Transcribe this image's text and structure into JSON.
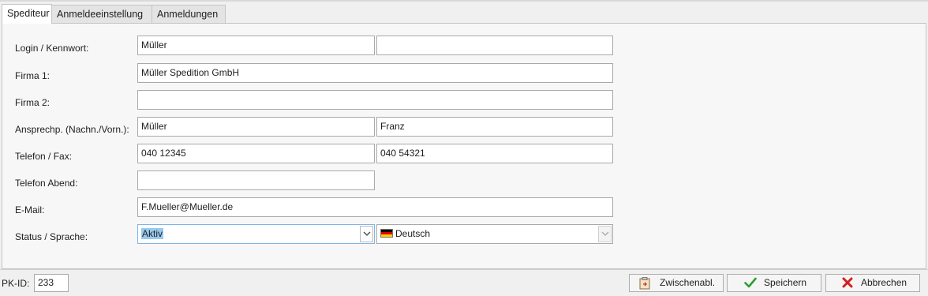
{
  "tabs": [
    {
      "label": "Spediteur",
      "active": true
    },
    {
      "label": "Anmeldeeinstellung",
      "active": false
    },
    {
      "label": "Anmeldungen",
      "active": false
    }
  ],
  "form": {
    "login": {
      "label": "Login / Kennwort:",
      "value": "Müller",
      "password": ""
    },
    "firma1": {
      "label": "Firma 1:",
      "value": "Müller Spedition GmbH"
    },
    "firma2": {
      "label": "Firma 2:",
      "value": ""
    },
    "ansprech": {
      "label": "Ansprechp. (Nachn./Vorn.):",
      "nachname": "Müller",
      "vorname": "Franz"
    },
    "telefon": {
      "label": "Telefon / Fax:",
      "telefon": "040 12345",
      "fax": "040 54321"
    },
    "telefon_abend": {
      "label": "Telefon Abend:",
      "value": ""
    },
    "email": {
      "label": "E-Mail:",
      "value": "F.Mueller@Mueller.de"
    },
    "status": {
      "label": "Status / Sprache:",
      "status": "Aktiv",
      "sprache": "Deutsch",
      "sprache_flag": "german-flag-icon"
    }
  },
  "footer": {
    "pk_label": "PK-ID:",
    "pk_value": "233",
    "buttons": {
      "clipboard": {
        "label": "Zwischenabl.",
        "icon": "clipboard-icon"
      },
      "save": {
        "label": "Speichern",
        "icon": "checkmark-icon",
        "color": "#2e9e2e"
      },
      "cancel": {
        "label": "Abbrechen",
        "icon": "close-x-icon",
        "color": "#d21e1e"
      }
    }
  }
}
